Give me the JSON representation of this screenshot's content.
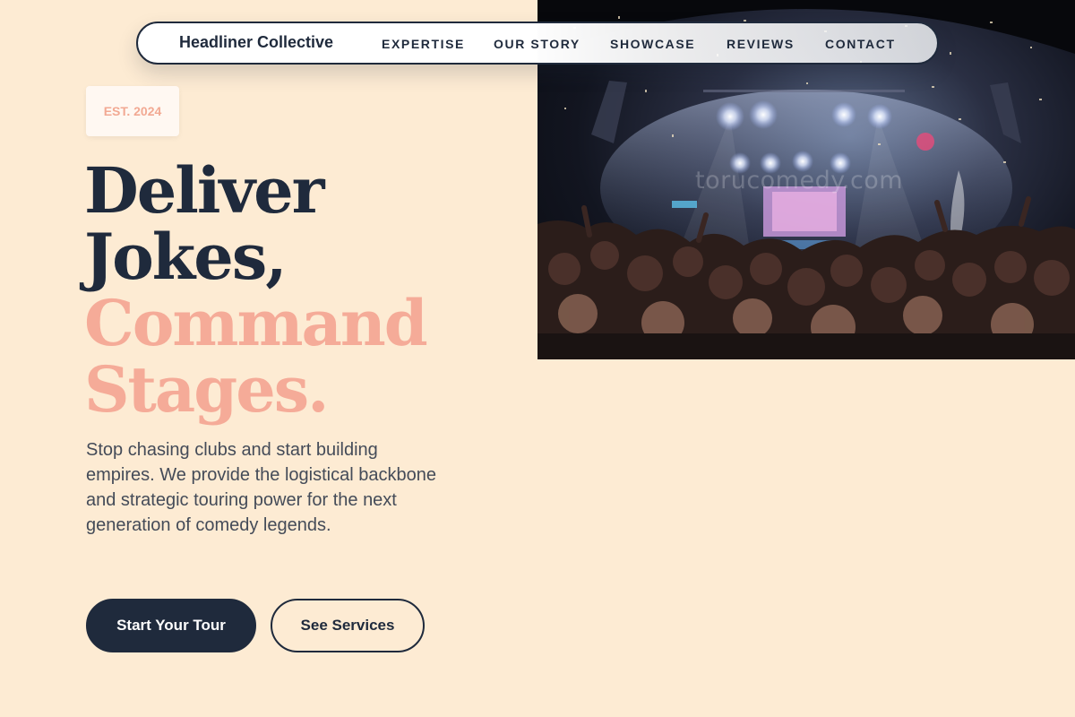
{
  "brand": "Headliner Collective",
  "nav": {
    "links": [
      "EXPERTISE",
      "OUR STORY",
      "SHOWCASE",
      "REVIEWS",
      "CONTACT"
    ]
  },
  "hero": {
    "badge": "EST. 2024",
    "headline": {
      "line1": "Deliver",
      "line2": "Jokes,",
      "line3": "Command",
      "line4": "Stages."
    },
    "intro": "Stop chasing clubs and start building empires. We provide the logistical backbone and strategic touring power for the next generation of comedy legends.",
    "primary_cta": "Start Your Tour",
    "secondary_cta": "See Services",
    "image_watermark": "torucomedy.com"
  },
  "colors": {
    "background": "#fdebd3",
    "navy": "#1f2a3c",
    "accent": "#f5ab98"
  }
}
